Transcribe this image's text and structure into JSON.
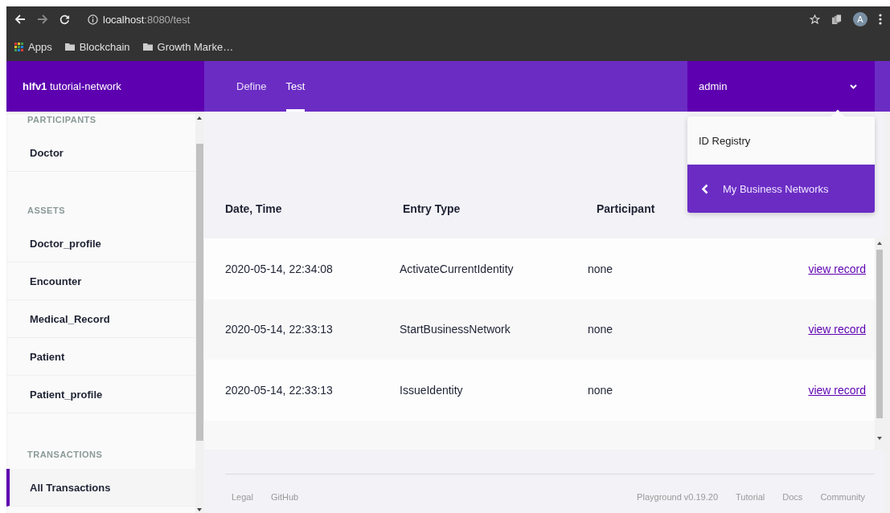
{
  "browser": {
    "url_host": "localhost",
    "url_rest": ":8080/test",
    "bookmarks": [
      {
        "label": "Apps",
        "kind": "apps"
      },
      {
        "label": "Blockchain",
        "kind": "folder"
      },
      {
        "label": "Growth Marke…",
        "kind": "folder"
      }
    ],
    "profile_initial": "A"
  },
  "header": {
    "brand": "**hlfv1** tutorial-network",
    "nav_tabs": [
      {
        "label": "Define",
        "selected": false
      },
      {
        "label": "Test",
        "selected": true
      }
    ],
    "user_menu": {
      "label": "admin",
      "expanded": true,
      "items": [
        {
          "label": "ID Registry",
          "kind": "plain"
        },
        {
          "label": "My Business Networks",
          "kind": "back"
        }
      ]
    }
  },
  "sidebar": {
    "sections": [
      {
        "heading": "PARTICIPANTS",
        "items": [
          {
            "label": "Doctor",
            "selected": false
          }
        ]
      },
      {
        "heading": "ASSETS",
        "items": [
          {
            "label": "Doctor_profile",
            "selected": false
          },
          {
            "label": "Encounter",
            "selected": false
          },
          {
            "label": "Medical_Record",
            "selected": false
          },
          {
            "label": "Patient",
            "selected": false
          },
          {
            "label": "Patient_profile",
            "selected": false
          }
        ]
      },
      {
        "heading": "TRANSACTIONS",
        "items": [
          {
            "label": "All Transactions",
            "selected": true
          }
        ]
      }
    ]
  },
  "table": {
    "columns": [
      "Date, Time",
      "Entry Type",
      "Participant"
    ],
    "rows": [
      {
        "date_time": "2020-05-14, 22:34:08",
        "entry_type": "ActivateCurrentIdentity",
        "participant": "none",
        "link": "view record"
      },
      {
        "date_time": "2020-05-14, 22:33:13",
        "entry_type": "StartBusinessNetwork",
        "participant": "none",
        "link": "view record"
      },
      {
        "date_time": "2020-05-14, 22:33:13",
        "entry_type": "IssueIdentity",
        "participant": "none",
        "link": "view record"
      }
    ]
  },
  "footer": {
    "left_links": [
      "Legal",
      "GitHub"
    ],
    "right_links": [
      "Playground v0.19.20",
      "Tutorial",
      "Docs",
      "Community"
    ]
  }
}
